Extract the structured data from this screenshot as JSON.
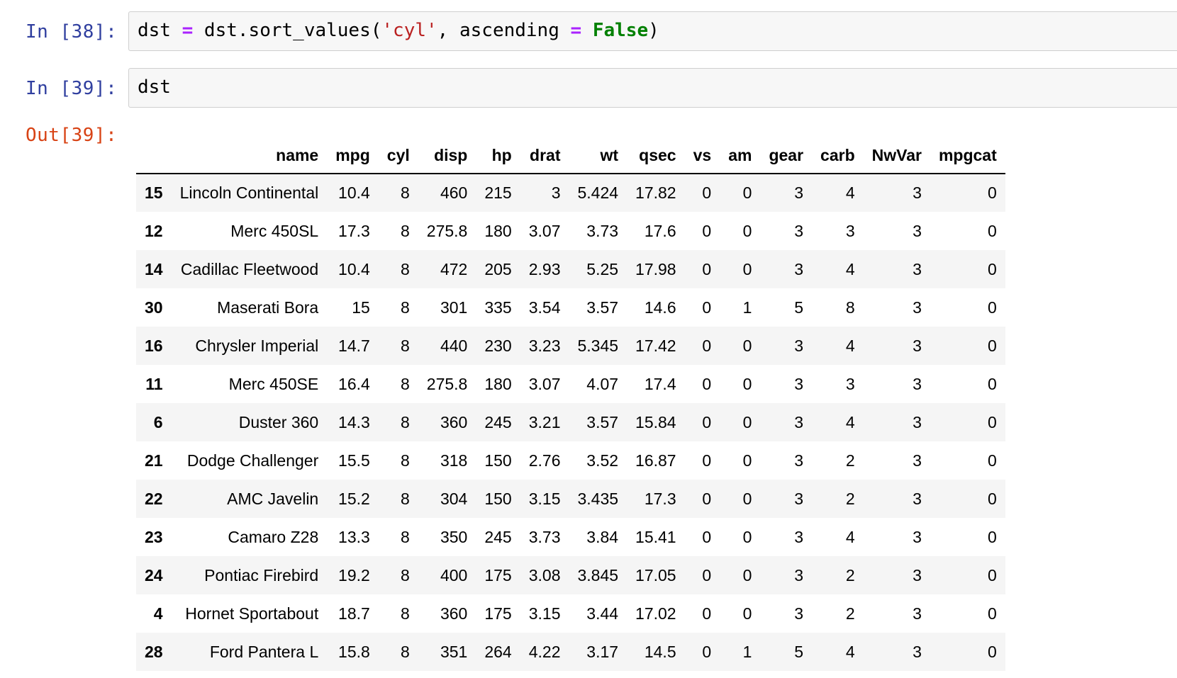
{
  "cells": {
    "cell38": {
      "prompt": "In [38]:",
      "code": {
        "t1": "dst ",
        "t2": "=",
        "t3": " dst.sort_values(",
        "t4": "'cyl'",
        "t5": ", ascending ",
        "t6": "=",
        "t7": " ",
        "t8": "False",
        "t9": ")"
      }
    },
    "cell39": {
      "prompt": "In [39]:",
      "code": "dst",
      "out_prompt": "Out[39]:"
    }
  },
  "dataframe": {
    "columns": [
      "",
      "name",
      "mpg",
      "cyl",
      "disp",
      "hp",
      "drat",
      "wt",
      "qsec",
      "vs",
      "am",
      "gear",
      "carb",
      "NwVar",
      "mpgcat"
    ],
    "rows": [
      [
        "15",
        "Lincoln Continental",
        "10.4",
        "8",
        "460",
        "215",
        "3",
        "5.424",
        "17.82",
        "0",
        "0",
        "3",
        "4",
        "3",
        "0"
      ],
      [
        "12",
        "Merc 450SL",
        "17.3",
        "8",
        "275.8",
        "180",
        "3.07",
        "3.73",
        "17.6",
        "0",
        "0",
        "3",
        "3",
        "3",
        "0"
      ],
      [
        "14",
        "Cadillac Fleetwood",
        "10.4",
        "8",
        "472",
        "205",
        "2.93",
        "5.25",
        "17.98",
        "0",
        "0",
        "3",
        "4",
        "3",
        "0"
      ],
      [
        "30",
        "Maserati Bora",
        "15",
        "8",
        "301",
        "335",
        "3.54",
        "3.57",
        "14.6",
        "0",
        "1",
        "5",
        "8",
        "3",
        "0"
      ],
      [
        "16",
        "Chrysler Imperial",
        "14.7",
        "8",
        "440",
        "230",
        "3.23",
        "5.345",
        "17.42",
        "0",
        "0",
        "3",
        "4",
        "3",
        "0"
      ],
      [
        "11",
        "Merc 450SE",
        "16.4",
        "8",
        "275.8",
        "180",
        "3.07",
        "4.07",
        "17.4",
        "0",
        "0",
        "3",
        "3",
        "3",
        "0"
      ],
      [
        "6",
        "Duster 360",
        "14.3",
        "8",
        "360",
        "245",
        "3.21",
        "3.57",
        "15.84",
        "0",
        "0",
        "3",
        "4",
        "3",
        "0"
      ],
      [
        "21",
        "Dodge Challenger",
        "15.5",
        "8",
        "318",
        "150",
        "2.76",
        "3.52",
        "16.87",
        "0",
        "0",
        "3",
        "2",
        "3",
        "0"
      ],
      [
        "22",
        "AMC Javelin",
        "15.2",
        "8",
        "304",
        "150",
        "3.15",
        "3.435",
        "17.3",
        "0",
        "0",
        "3",
        "2",
        "3",
        "0"
      ],
      [
        "23",
        "Camaro Z28",
        "13.3",
        "8",
        "350",
        "245",
        "3.73",
        "3.84",
        "15.41",
        "0",
        "0",
        "3",
        "4",
        "3",
        "0"
      ],
      [
        "24",
        "Pontiac Firebird",
        "19.2",
        "8",
        "400",
        "175",
        "3.08",
        "3.845",
        "17.05",
        "0",
        "0",
        "3",
        "2",
        "3",
        "0"
      ],
      [
        "4",
        "Hornet Sportabout",
        "18.7",
        "8",
        "360",
        "175",
        "3.15",
        "3.44",
        "17.02",
        "0",
        "0",
        "3",
        "2",
        "3",
        "0"
      ],
      [
        "28",
        "Ford Pantera L",
        "15.8",
        "8",
        "351",
        "264",
        "4.22",
        "3.17",
        "14.5",
        "0",
        "1",
        "5",
        "4",
        "3",
        "0"
      ]
    ]
  }
}
